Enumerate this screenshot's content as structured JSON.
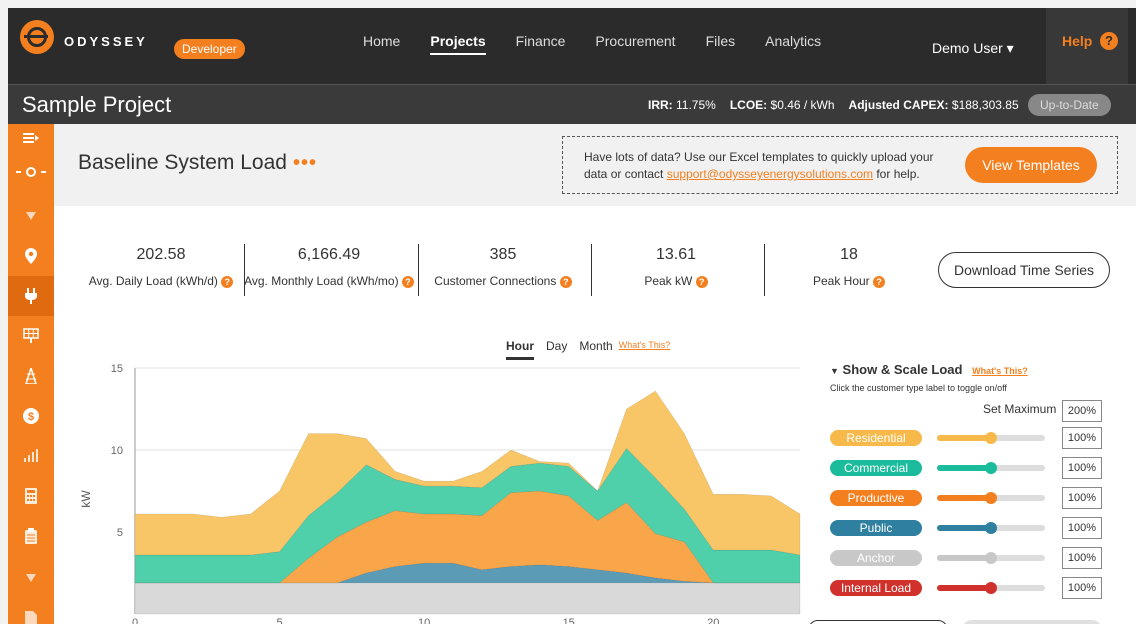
{
  "brand": "ODYSSEY",
  "dev_badge": "Developer",
  "nav": [
    "Home",
    "Projects",
    "Finance",
    "Procurement",
    "Files",
    "Analytics"
  ],
  "nav_active": "Projects",
  "user": "Demo User ▾",
  "help": "Help",
  "help_q": "?",
  "project": {
    "title": "Sample Project",
    "irr_label": "IRR:",
    "irr": "11.75%",
    "lcoe_label": "LCOE:",
    "lcoe": "$0.46 / kWh",
    "capex_label": "Adjusted CAPEX:",
    "capex": "$188,303.85",
    "status": "Up-to-Date"
  },
  "sidebar_icons": [
    "menu-icon",
    "circle-icon",
    "chevron-down-icon",
    "location-pin-icon",
    "plug-icon",
    "solar-panel-icon",
    "tower-icon",
    "dollar-icon",
    "chart-icon",
    "calculator-icon",
    "clipboard-icon",
    "chevron-down-icon",
    "document-icon"
  ],
  "section": {
    "title": "Baseline System Load",
    "dots": "•••",
    "templ_text_1": "Have lots of data? Use our Excel templates to quickly upload your data or contact ",
    "templ_email": "support@odysseyenergysolutions.com",
    "templ_text_2": " for help.",
    "templ_button": "View Templates"
  },
  "stats": [
    {
      "value": "202.58",
      "label": "Avg. Daily Load (kWh/d)"
    },
    {
      "value": "6,166.49",
      "label": "Avg. Monthly Load (kWh/mo)"
    },
    {
      "value": "385",
      "label": "Customer Connections"
    },
    {
      "value": "13.61",
      "label": "Peak kW"
    },
    {
      "value": "18",
      "label": "Peak Hour"
    }
  ],
  "download_button": "Download Time Series",
  "time_tabs": [
    "Hour",
    "Day",
    "Month"
  ],
  "time_tab_active": "Hour",
  "whats_this": "What's This?",
  "panel": {
    "title": "Show & Scale Load",
    "subtitle": "Click the customer type label to toggle on/off",
    "set_max_label": "Set Maximum",
    "set_max_value": "200%",
    "types": [
      {
        "label": "Residential",
        "color": "#f7b94a",
        "pct": "100%",
        "level": 0.5
      },
      {
        "label": "Commercial",
        "color": "#1abc9c",
        "pct": "100%",
        "level": 0.5
      },
      {
        "label": "Productive",
        "color": "#f47f1f",
        "pct": "100%",
        "level": 0.5
      },
      {
        "label": "Public",
        "color": "#2f7fa0",
        "pct": "100%",
        "level": 0.5
      },
      {
        "label": "Anchor",
        "color": "#c8c8c8",
        "pct": "100%",
        "level": 0.5
      },
      {
        "label": "Internal Load",
        "color": "#d0312d",
        "pct": "100%",
        "level": 0.5
      }
    ]
  },
  "chart_data": {
    "type": "area",
    "ylabel": "kW",
    "ylim": [
      0,
      15
    ],
    "yticks": [
      5,
      10,
      15
    ],
    "xticks": [
      0,
      5,
      10,
      15,
      20
    ],
    "xlim": [
      0,
      23
    ],
    "grid": true,
    "x": [
      0,
      1,
      2,
      3,
      4,
      5,
      6,
      7,
      8,
      9,
      10,
      11,
      12,
      13,
      14,
      15,
      16,
      17,
      18,
      19,
      20,
      21,
      22,
      23
    ],
    "series": [
      {
        "name": "Anchor",
        "color": "#d9d9d9",
        "values": [
          1.9,
          1.9,
          1.9,
          1.9,
          1.9,
          1.9,
          1.9,
          1.9,
          1.9,
          1.9,
          1.9,
          1.9,
          1.9,
          1.9,
          1.9,
          1.9,
          1.9,
          1.9,
          1.9,
          1.9,
          1.9,
          1.9,
          1.9,
          1.9
        ]
      },
      {
        "name": "Public",
        "color": "#5b9bb5",
        "values": [
          0,
          0,
          0,
          0,
          0,
          0,
          0,
          0,
          0.6,
          1.0,
          1.2,
          1.2,
          0.8,
          1.0,
          1.1,
          1.0,
          0.8,
          0.6,
          0.3,
          0.1,
          0,
          0,
          0,
          0
        ]
      },
      {
        "name": "Productive",
        "color": "#f9a64a",
        "values": [
          0,
          0,
          0,
          0,
          0,
          0,
          1.5,
          2.8,
          3.1,
          3.4,
          3.0,
          3.0,
          3.3,
          4.5,
          4.5,
          4.3,
          3.0,
          4.3,
          2.7,
          2.4,
          0,
          0,
          0,
          0
        ]
      },
      {
        "name": "Commercial",
        "color": "#4fcfaa",
        "values": [
          1.7,
          1.7,
          1.7,
          1.7,
          1.7,
          1.9,
          2.6,
          2.7,
          3.5,
          1.9,
          1.7,
          1.7,
          1.7,
          1.6,
          1.7,
          1.8,
          1.8,
          3.3,
          3.4,
          2.0,
          2.0,
          2.0,
          2.0,
          1.7
        ]
      },
      {
        "name": "Residential",
        "color": "#f8c567",
        "values": [
          2.5,
          2.5,
          2.5,
          2.3,
          2.5,
          3.7,
          5.0,
          3.6,
          1.6,
          0.5,
          0.3,
          0.3,
          1.0,
          1.0,
          0.1,
          0.2,
          0.0,
          2.4,
          5.3,
          4.6,
          3.4,
          3.4,
          3.3,
          2.5
        ]
      }
    ]
  }
}
